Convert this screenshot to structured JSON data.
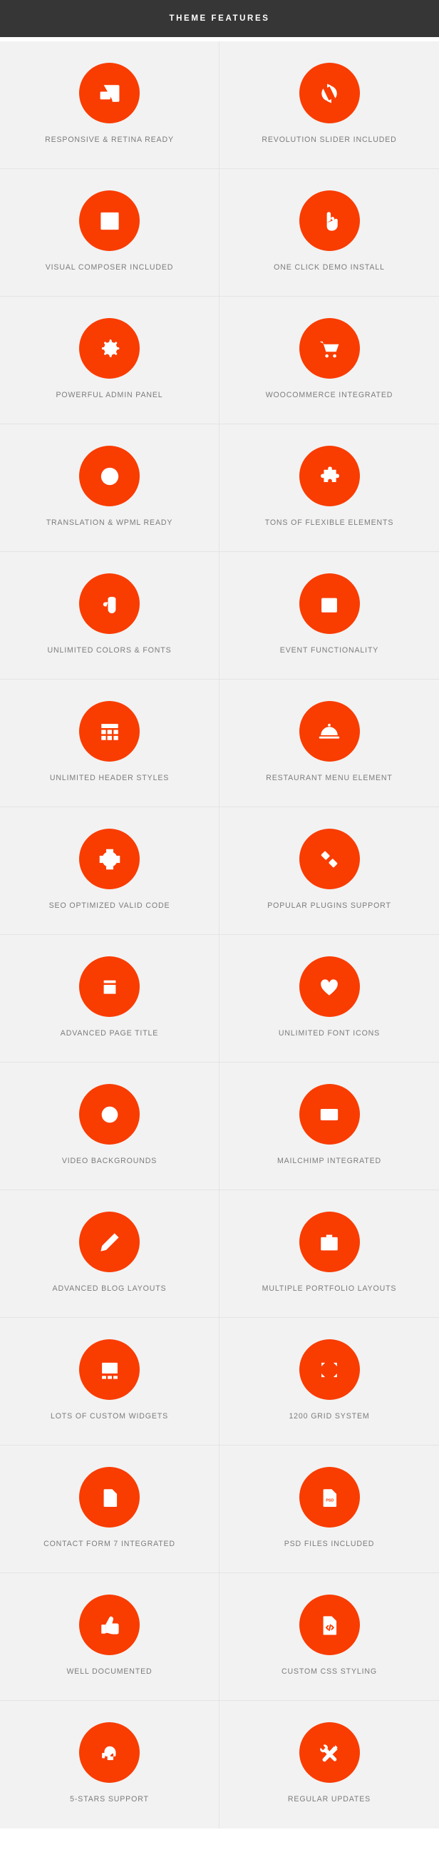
{
  "header": {
    "title": "THEME FEATURES"
  },
  "colors": {
    "accent": "#f93c00",
    "header_background": "#363636",
    "cell_background": "#f2f2f2",
    "label_text": "#7c7c7c",
    "divider": "#e4e4e4"
  },
  "features": [
    {
      "label": "RESPONSIVE & RETINA READY",
      "icon": "responsive-devices-icon"
    },
    {
      "label": "REVOLUTION SLIDER INCLUDED",
      "icon": "refresh-cycle-icon"
    },
    {
      "label": "VISUAL COMPOSER INCLUDED",
      "icon": "code-browser-icon"
    },
    {
      "label": "ONE CLICK DEMO INSTALL",
      "icon": "pointing-hand-icon"
    },
    {
      "label": "POWERFUL ADMIN PANEL",
      "icon": "gear-icon"
    },
    {
      "label": "WOOCOMMERCE INTEGRATED",
      "icon": "shopping-cart-icon"
    },
    {
      "label": "TRANSLATION & WPML READY",
      "icon": "globe-icon"
    },
    {
      "label": "TONS OF FLEXIBLE ELEMENTS",
      "icon": "puzzle-piece-icon"
    },
    {
      "label": "UNLIMITED COLORS & FONTS",
      "icon": "paint-bucket-icon"
    },
    {
      "label": "EVENT FUNCTIONALITY",
      "icon": "calendar-icon"
    },
    {
      "label": "UNLIMITED HEADER STYLES",
      "icon": "grid-layout-icon"
    },
    {
      "label": "RESTAURANT MENU ELEMENT",
      "icon": "food-cloche-icon"
    },
    {
      "label": "SEO OPTIMIZED VALID CODE",
      "icon": "crosshair-target-icon"
    },
    {
      "label": "POPULAR PLUGINS SUPPORT",
      "icon": "plug-connector-icon"
    },
    {
      "label": "ADVANCED PAGE TITLE",
      "icon": "page-title-block-icon"
    },
    {
      "label": "UNLIMITED FONT ICONS",
      "icon": "heart-icon"
    },
    {
      "label": "VIDEO BACKGROUNDS",
      "icon": "play-circle-icon"
    },
    {
      "label": "MAILCHIMP INTEGRATED",
      "icon": "envelope-icon"
    },
    {
      "label": "ADVANCED BLOG LAYOUTS",
      "icon": "pencil-icon"
    },
    {
      "label": "MULTIPLE PORTFOLIO LAYOUTS",
      "icon": "briefcase-icon"
    },
    {
      "label": "LOTS OF CUSTOM WIDGETS",
      "icon": "widgets-layout-icon"
    },
    {
      "label": "1200 GRID SYSTEM",
      "icon": "fullscreen-frame-icon"
    },
    {
      "label": "CONTACT FORM 7 INTEGRATED",
      "icon": "document-lines-icon"
    },
    {
      "label": "PSD FILES INCLUDED",
      "icon": "psd-file-icon"
    },
    {
      "label": "WELL DOCUMENTED",
      "icon": "thumbs-up-icon"
    },
    {
      "label": "CUSTOM CSS STYLING",
      "icon": "code-file-icon"
    },
    {
      "label": "5-STARS SUPPORT",
      "icon": "headset-support-icon"
    },
    {
      "label": "REGULAR UPDATES",
      "icon": "wrench-screwdriver-icon"
    }
  ]
}
